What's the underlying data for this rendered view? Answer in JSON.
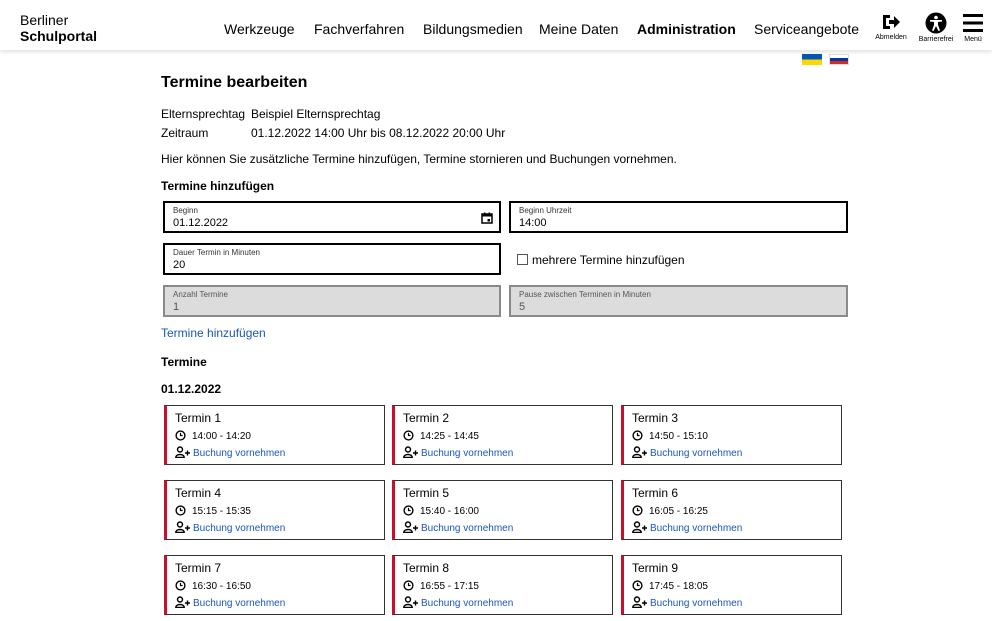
{
  "header": {
    "brand_line1": "Berliner",
    "brand_line2": "Schulportal",
    "nav": [
      "Werkzeuge",
      "Fachverfahren",
      "Bildungsmedien",
      "Meine Daten",
      "Administration",
      "Serviceangebote"
    ],
    "active_nav": "Administration",
    "icons": [
      {
        "name": "logout-icon",
        "label": "Abmelden"
      },
      {
        "name": "accessibility-icon",
        "label": "Barrierefrei"
      },
      {
        "name": "menu-icon",
        "label": "Menü"
      }
    ]
  },
  "flags": [
    {
      "name": "ukraine-flag",
      "colors": [
        "#0057b7",
        "#ffd700"
      ]
    },
    {
      "name": "russia-flag",
      "colors": [
        "#ffffff",
        "#0039a6",
        "#d52b1e"
      ]
    }
  ],
  "page": {
    "title": "Termine bearbeiten",
    "meta": [
      {
        "key": "Elternsprechtag",
        "value": "Beispiel Elternsprechtag"
      },
      {
        "key": "Zeitraum",
        "value": "01.12.2022 14:00 Uhr bis 08.12.2022 20:00 Uhr"
      }
    ],
    "description": "Hier können Sie zusätzliche Termine hinzufügen, Termine stornieren und Buchungen vornehmen.",
    "add_section_title": "Termine hinzufügen",
    "fields": {
      "beginn": {
        "label": "Beginn",
        "value": "01.12.2022"
      },
      "beginn_uhrzeit": {
        "label": "Beginn Uhrzeit",
        "value": "14:00"
      },
      "dauer": {
        "label": "Dauer Termin in Minuten",
        "value": "20"
      },
      "anzahl": {
        "label": "Anzahl Termine",
        "value": "1"
      },
      "pause": {
        "label": "Pause zwischen Terminen in Minuten",
        "value": "5"
      }
    },
    "checkbox_label": "mehrere Termine hinzufügen",
    "add_link": "Termine hinzufügen",
    "list_title": "Termine",
    "date": "01.12.2022",
    "booking_label": "Buchung vornehmen",
    "accent_color": "#c8102e",
    "link_color": "#1a56b8",
    "slots": [
      {
        "name": "Termin 1",
        "time": "14:00 - 14:20"
      },
      {
        "name": "Termin 2",
        "time": "14:25 - 14:45"
      },
      {
        "name": "Termin 3",
        "time": "14:50 - 15:10"
      },
      {
        "name": "Termin 4",
        "time": "15:15 - 15:35"
      },
      {
        "name": "Termin 5",
        "time": "15:40 - 16:00"
      },
      {
        "name": "Termin 6",
        "time": "16:05 - 16:25"
      },
      {
        "name": "Termin 7",
        "time": "16:30 - 16:50"
      },
      {
        "name": "Termin 8",
        "time": "16:55 - 17:15"
      },
      {
        "name": "Termin 9",
        "time": "17:45 - 18:05"
      }
    ]
  }
}
